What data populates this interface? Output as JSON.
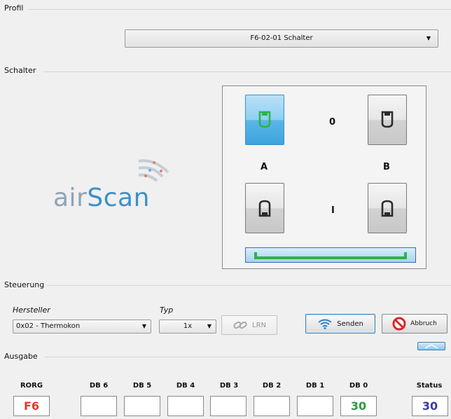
{
  "profile": {
    "group_label": "Profil",
    "selected": "F6-02-01 Schalter"
  },
  "switch": {
    "group_label": "Schalter",
    "logo_part1": "air",
    "logo_part2": "Scan",
    "state_0": "0",
    "state_i": "I",
    "channel_a": "A",
    "channel_b": "B",
    "active_rocker": "A0",
    "accent_color": "#3ca4dd",
    "bar_color": "#2db34a"
  },
  "control": {
    "group_label": "Steuerung",
    "manufacturer_label": "Hersteller",
    "manufacturer_value": "0x02 - Thermokon",
    "type_label": "Typ",
    "type_value": "1x",
    "lrn_label": "LRN",
    "send_label": "Senden",
    "abort_label": "Abbruch"
  },
  "output": {
    "group_label": "Ausgabe",
    "columns": [
      {
        "header": "RORG",
        "value": "F6",
        "color": "#e23b2e"
      },
      {
        "header": "DB 6",
        "value": ""
      },
      {
        "header": "DB 5",
        "value": ""
      },
      {
        "header": "DB 4",
        "value": ""
      },
      {
        "header": "DB 3",
        "value": ""
      },
      {
        "header": "DB 2",
        "value": ""
      },
      {
        "header": "DB 1",
        "value": ""
      },
      {
        "header": "DB 0",
        "value": "30",
        "color": "#2a9a3e"
      },
      {
        "header": "Status",
        "value": "30",
        "color": "#3a3aa0"
      }
    ]
  }
}
